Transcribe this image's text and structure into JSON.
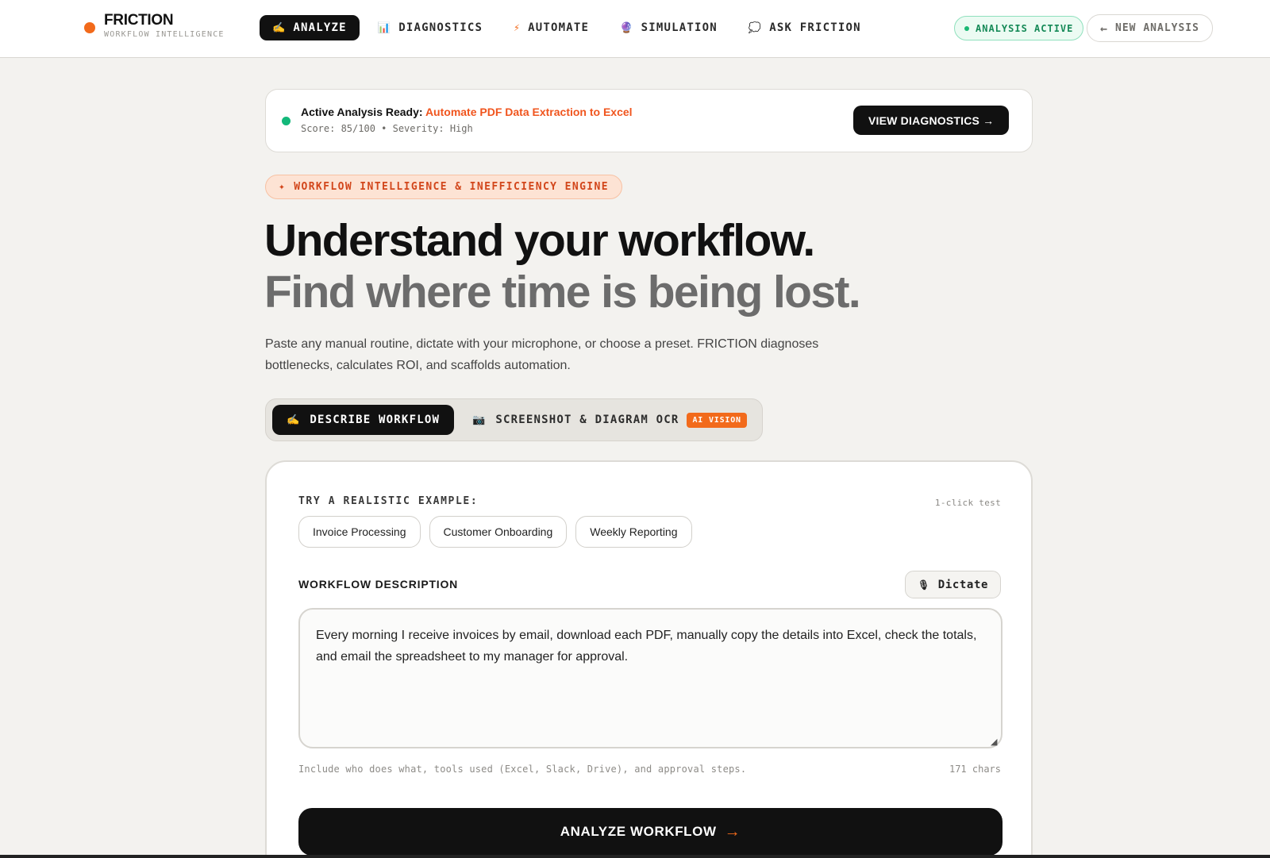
{
  "brand": {
    "name": "FRICTION",
    "tagline": "WORKFLOW INTELLIGENCE",
    "dot_color": "#f26a1b"
  },
  "nav": {
    "tabs": [
      {
        "icon": "✍️",
        "icon_name": "writing-hand-icon",
        "label": "ANALYZE",
        "active": true
      },
      {
        "icon": "📊",
        "icon_name": "bar-chart-icon",
        "label": "DIAGNOSTICS"
      },
      {
        "icon": "⚡",
        "icon_name": "lightning-icon",
        "label": "AUTOMATE"
      },
      {
        "icon": "🔮",
        "icon_name": "crystal-ball-icon",
        "label": "SIMULATION"
      },
      {
        "icon": "💭",
        "icon_name": "thought-bubble-icon",
        "label": "ASK FRICTION"
      }
    ],
    "status": "ANALYSIS ACTIVE",
    "new_analysis": "NEW ANALYSIS",
    "new_analysis_icon": "←"
  },
  "banner": {
    "prefix": "Active Analysis Ready:",
    "title": "Automate PDF Data Extraction to Excel",
    "meta": "Score: 85/100 • Severity: High",
    "button": "VIEW DIAGNOSTICS →",
    "status_color": "#13b87a"
  },
  "eyebrow": {
    "icon": "✦",
    "label": "WORKFLOW INTELLIGENCE & INEFFICIENCY ENGINE"
  },
  "hero": {
    "line1": "Understand your workflow.",
    "line2": "Find where time is being lost.",
    "description": "Paste any manual routine, dictate with your microphone, or choose a preset. FRICTION diagnoses bottlenecks, calculates ROI, and scaffolds automation."
  },
  "mode": {
    "describe": {
      "icon": "✍️",
      "label": "DESCRIBE WORKFLOW"
    },
    "ocr": {
      "icon": "📷",
      "label": "SCREENSHOT & DIAGRAM OCR",
      "tag": "AI VISION"
    }
  },
  "examples": {
    "label": "TRY A REALISTIC EXAMPLE:",
    "hint": "1-click test",
    "items": [
      "Invoice Processing",
      "Customer Onboarding",
      "Weekly Reporting"
    ]
  },
  "workflow": {
    "label": "WORKFLOW DESCRIPTION",
    "dictate": "Dictate",
    "dictate_icon": "🎙",
    "value": "Every morning I receive invoices by email, download each PDF, manually copy the details into Excel, check the totals, and email the spreadsheet to my manager for approval.",
    "helper": "Include who does what, tools used (Excel, Slack, Drive), and approval steps.",
    "char_count": "171 chars"
  },
  "submit": {
    "label": "ANALYZE WORKFLOW",
    "arrow": "→"
  },
  "colors": {
    "accent": "#f26a1b",
    "success": "#13b87a",
    "ink": "#111111",
    "background": "#f3f2ef"
  }
}
